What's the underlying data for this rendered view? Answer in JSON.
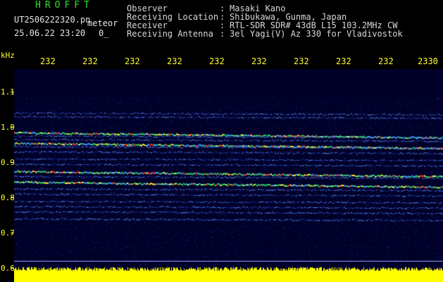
{
  "brand": "HROFFT",
  "file_name": "UT2506222320.pn",
  "meteor_label": "meteor",
  "date_time": "25.06.22 23:20",
  "counter": "0_",
  "info": [
    {
      "label": "Observer",
      "value": "Masaki Kano"
    },
    {
      "label": "Receiving Location",
      "value": "Shibukawa, Gunma, Japan"
    },
    {
      "label": "Receiver",
      "value": "RTL-SDR SDR# 43dB L15 103.2MHz CW"
    },
    {
      "label": "Receiving Antenna",
      "value": "3el Yagi(V) Az 330 for Vladivostok"
    }
  ],
  "yaxis": {
    "unit": "kHz",
    "ticks": [
      "1.1",
      "1.0",
      "0.9",
      "0.8",
      "0.7",
      "0.6"
    ]
  },
  "time_ticks": [
    "232",
    "232",
    "232",
    "232",
    "232",
    "232",
    "232",
    "232",
    "232",
    "2330"
  ],
  "colors": {
    "background": "#000000",
    "spectro_bg": "#000033",
    "axis": "#ffff33",
    "brand": "#2fe22f",
    "noise_bar": "#ffff00"
  },
  "spectro_lines_khz": [
    1.04,
    1.03,
    0.985,
    0.975,
    0.965,
    0.955,
    0.945,
    0.93,
    0.91,
    0.895,
    0.875,
    0.86,
    0.845,
    0.825,
    0.81,
    0.79,
    0.775,
    0.76,
    0.74
  ]
}
